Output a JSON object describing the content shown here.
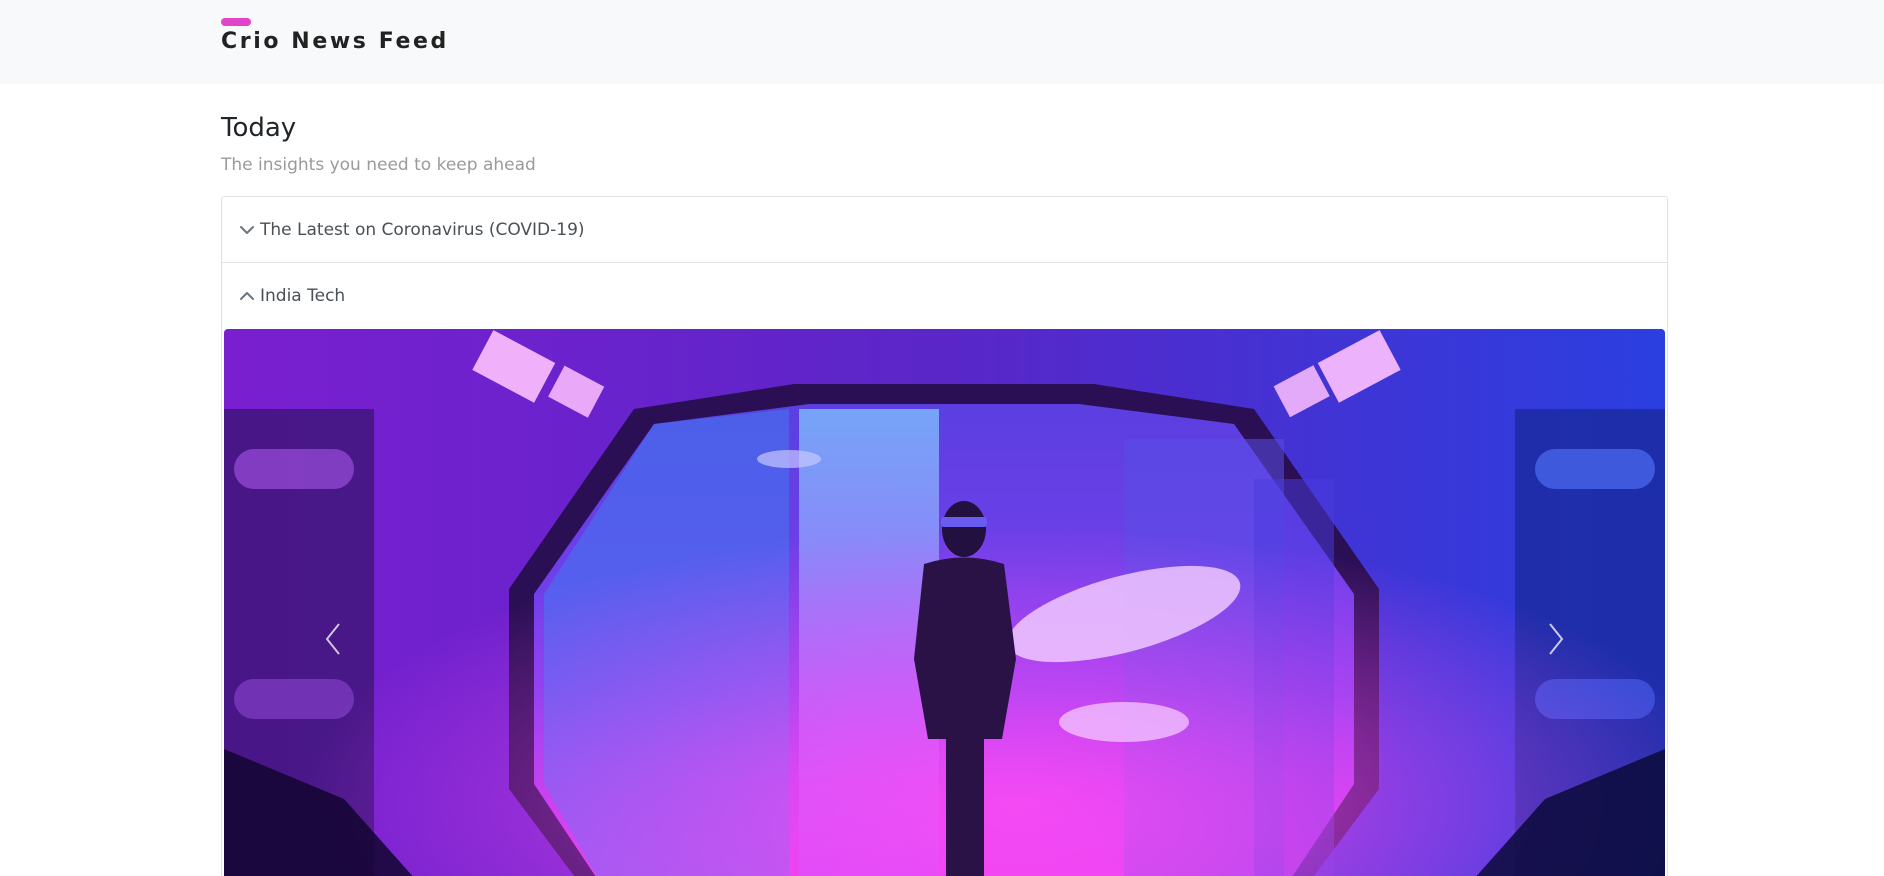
{
  "navbar": {
    "brand": "Crio News Feed",
    "accent_color": "#e044c8"
  },
  "page": {
    "title": "Today",
    "subtitle": "The insights you need to keep ahead"
  },
  "accordion": {
    "items": [
      {
        "label": "The Latest on Coronavirus (COVID-19)",
        "expanded": false,
        "icon": "chevron-down-icon"
      },
      {
        "label": "India Tech",
        "expanded": true,
        "icon": "chevron-up-icon"
      }
    ]
  },
  "carousel": {
    "controls": {
      "prev_icon": "chevron-left-icon",
      "next_icon": "chevron-right-icon"
    },
    "colors": {
      "magenta": "#e23cf0",
      "violet": "#6a2bd6",
      "blue": "#2d4dff",
      "dark": "#1a0b3c"
    }
  }
}
